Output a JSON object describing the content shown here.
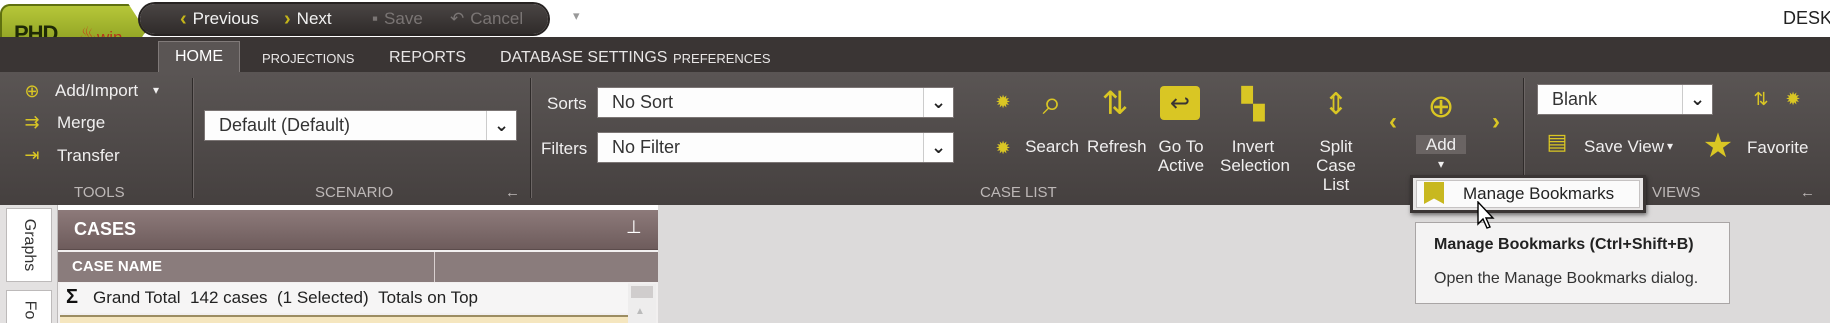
{
  "app": {
    "logo_text": "PHD",
    "logo_suffix": "win",
    "window_title": "DESKT"
  },
  "quick_access": {
    "previous": "Previous",
    "next": "Next",
    "save": "Save",
    "cancel": "Cancel"
  },
  "tabs": [
    "HOME",
    "PROJECTIONS",
    "REPORTS",
    "DATABASE SETTINGS",
    "PREFERENCES"
  ],
  "tools": {
    "add_import": "Add/Import",
    "merge": "Merge",
    "transfer": "Transfer",
    "group": "TOOLS"
  },
  "scenario": {
    "value": "Default (Default)",
    "group": "SCENARIO"
  },
  "case_list": {
    "sorts_label": "Sorts",
    "sorts_value": "No Sort",
    "filters_label": "Filters",
    "filters_value": "No Filter",
    "search": "Search",
    "refresh": "Refresh",
    "go_to": "Go To",
    "active": "Active",
    "invert": "Invert",
    "selection": "Selection",
    "split_case": "Split Case",
    "list": "List",
    "add": "Add",
    "group": "CASE LIST"
  },
  "views": {
    "value": "Blank",
    "save_view": "Save View",
    "favorite": "Favorite",
    "group": "VIEWS"
  },
  "dropdown": {
    "manage_bookmarks": "Manage Bookmarks"
  },
  "tooltip": {
    "title": "Manage Bookmarks (Ctrl+Shift+B)",
    "description": "Open the Manage Bookmarks dialog."
  },
  "side_tabs": [
    "Graphs",
    "Fo"
  ],
  "cases_panel": {
    "title": "CASES",
    "column": "CASE NAME",
    "grand_total_label": "Grand Total",
    "case_count": "142 cases",
    "selected": "(1 Selected)",
    "totals": "Totals on Top"
  },
  "colors": {
    "accent": "#c8b820",
    "ribbon": "#4f4a49",
    "panel_header": "#7c6a6a"
  }
}
